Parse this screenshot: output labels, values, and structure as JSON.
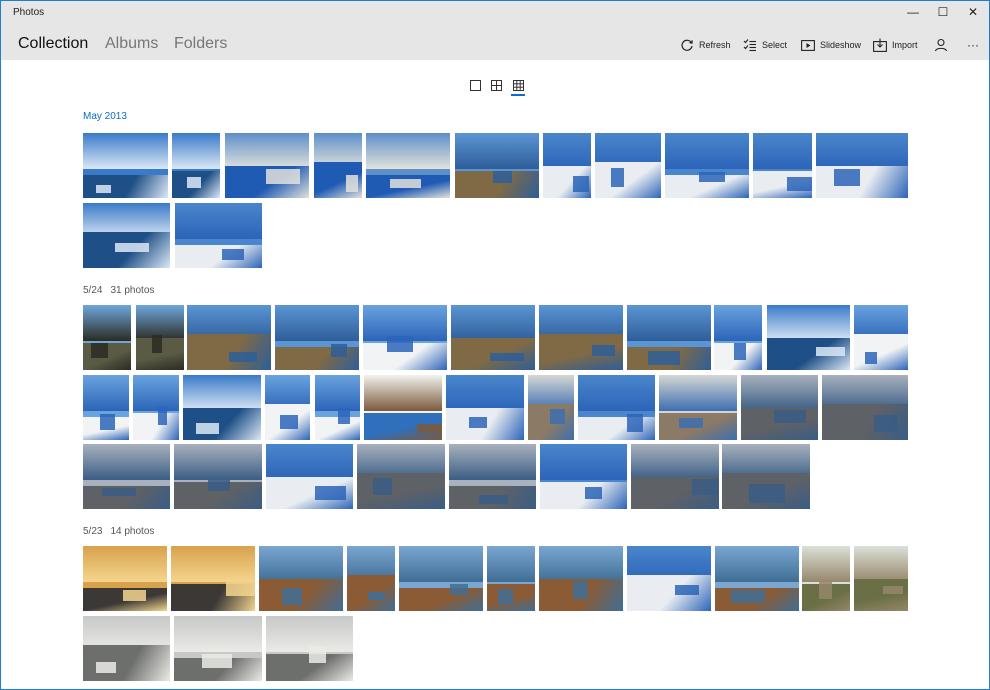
{
  "app": {
    "title": "Photos"
  },
  "window_controls": {
    "minimize": "—",
    "maximize": "☐",
    "close": "✕"
  },
  "nav": {
    "collection": "Collection",
    "albums": "Albums",
    "folders": "Folders"
  },
  "commands": {
    "refresh": "Refresh",
    "select": "Select",
    "slideshow": "Slideshow",
    "import": "Import",
    "more": "···"
  },
  "groups": [
    {
      "label": "May 2013",
      "count": ""
    },
    {
      "label": "5/24",
      "count": "31 photos"
    },
    {
      "label": "5/23",
      "count": "14 photos"
    }
  ],
  "colors": {
    "accent": "#0a6ecb",
    "titlebar": "#e6e6e6",
    "border": "#1a7fd6"
  },
  "photo_palettes": {
    "sea": [
      "#3a7ac8",
      "#1e4f86",
      "#dbe8f6"
    ],
    "pool": [
      "#5d8fc9",
      "#1f5ab3",
      "#e2e2dc"
    ],
    "village": [
      "#4a86cc",
      "#e9edf1",
      "#2c64b8"
    ],
    "tree": [
      "#6ea7db",
      "#5a5a45",
      "#2b2b22"
    ],
    "cliff": [
      "#5b95d4",
      "#7f6a45",
      "#2e5e99"
    ],
    "church": [
      "#6aa3de",
      "#f1f3f5",
      "#2c64b8"
    ],
    "door": [
      "#f2f2ee",
      "#2f6fbb",
      "#7b5a3d"
    ],
    "cloudy": [
      "#a8b1bd",
      "#5e6166",
      "#3a5d85"
    ],
    "stairs": [
      "#d5d6d4",
      "#8a7a66",
      "#3d6fb0"
    ],
    "sunset": [
      "#d8a24c",
      "#3b3836",
      "#f4d58e"
    ],
    "rock": [
      "#7aa6d1",
      "#8a5b35",
      "#3f6e95"
    ],
    "arch": [
      "#dce0d8",
      "#6b6f45",
      "#95876b"
    ],
    "haze": [
      "#c7c9c8",
      "#6d6f6c",
      "#eaeae6"
    ]
  }
}
